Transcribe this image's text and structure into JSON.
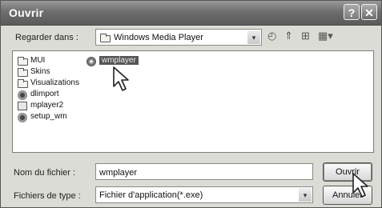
{
  "window": {
    "title": "Ouvrir",
    "help_glyph": "?",
    "close_glyph": "✕"
  },
  "lookin": {
    "label": "Regarder dans :",
    "value": "Windows Media Player",
    "dropdown_glyph": "▾"
  },
  "toolbar": {
    "back_glyph": "◴",
    "up_glyph": "⇑",
    "newfolder_glyph": "⊞",
    "views_glyph": "▦▾"
  },
  "files": [
    {
      "name": "MUI",
      "icon": "folder-icon"
    },
    {
      "name": "Skins",
      "icon": "folder-icon"
    },
    {
      "name": "Visualizations",
      "icon": "folder-icon"
    },
    {
      "name": "dlimport",
      "icon": "gear-icon"
    },
    {
      "name": "mplayer2",
      "icon": "application-icon"
    },
    {
      "name": "setup_wm",
      "icon": "gear-icon"
    },
    {
      "name": "wmplayer",
      "icon": "media-player-icon",
      "selected": true
    }
  ],
  "filename": {
    "label": "Nom du fichier :",
    "value": "wmplayer"
  },
  "filetype": {
    "label": "Fichiers de type :",
    "value": "Fichier d'application(*.exe)",
    "dropdown_glyph": "▾"
  },
  "buttons": {
    "open": "Ouvrir",
    "cancel": "Annuler"
  }
}
